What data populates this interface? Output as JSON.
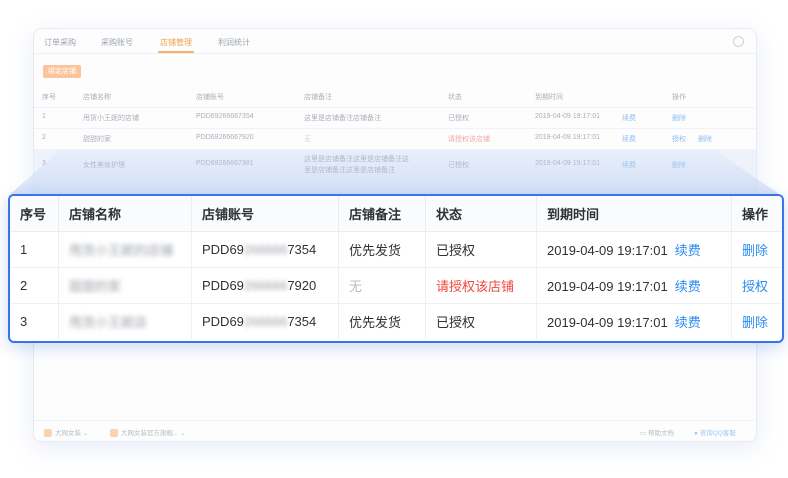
{
  "background": {
    "tabs": [
      "订单采购",
      "采购账号",
      "店铺管理",
      "利润统计"
    ],
    "active_tab": "店铺管理",
    "bind_button": "绑定店铺",
    "headers": [
      "序号",
      "店铺名称",
      "店铺账号",
      "店铺备注",
      "状态",
      "到期时间",
      "操作"
    ],
    "rows": [
      {
        "no": "1",
        "name": "甩货小王妮的店铺",
        "account": "PDD69266667354",
        "note": "这里是店铺备注店铺备注",
        "status": "已授权",
        "expire": "2019-04-09 19:17:01",
        "renew": "续费",
        "action": "删除"
      },
      {
        "no": "2",
        "name": "甜甜的家",
        "account": "PDD69266667920",
        "note": "无",
        "status": "请授权该店铺",
        "expire": "2019-04-09 19:17:01",
        "renew": "续费",
        "action": "授权",
        "action2": "删除"
      },
      {
        "no": "3",
        "name": "女性美妆护理",
        "account": "PDD69266667381",
        "note": "这里是店铺备注这里是店铺备注这",
        "note2": "里是店铺备注这里是店铺备注",
        "status": "已授权",
        "expire": "2019-04-09 19:17:01",
        "renew": "续费",
        "action": "删除"
      }
    ],
    "footer": {
      "left1": "大网女装",
      "left2": "大网女装官方旗舰...",
      "help": "帮助文档",
      "qq": "咨询QQ客服"
    }
  },
  "zoom": {
    "headers": {
      "no": "序号",
      "name": "店铺名称",
      "account": "店铺账号",
      "note": "店铺备注",
      "status": "状态",
      "expire": "到期时间",
      "action": "操作"
    },
    "rows": [
      {
        "no": "1",
        "name": "甩货小王妮的店铺",
        "acc_pre": "PDD69",
        "acc_mid": "266666",
        "acc_suf": "7354",
        "note": "优先发货",
        "status": "已授权",
        "expire": "2019-04-09 19:17:01",
        "renew": "续费",
        "action": "删除"
      },
      {
        "no": "2",
        "name": "甜甜的家",
        "acc_pre": "PDD69",
        "acc_mid": "266666",
        "acc_suf": "7920",
        "note": "无",
        "status": "请授权该店铺",
        "expire": "2019-04-09 19:17:01",
        "renew": "续费",
        "action": "授权"
      },
      {
        "no": "3",
        "name": "甩货小王妮店",
        "acc_pre": "PDD69",
        "acc_mid": "266666",
        "acc_suf": "7354",
        "note": "优先发货",
        "status": "已授权",
        "expire": "2019-04-09 19:17:01",
        "renew": "续费",
        "action": "删除"
      }
    ]
  },
  "colors": {
    "accent_blue": "#2d8cf0",
    "frame_blue": "#3b73e8",
    "warning_red": "#f0483e",
    "tab_orange": "#f0a050"
  }
}
